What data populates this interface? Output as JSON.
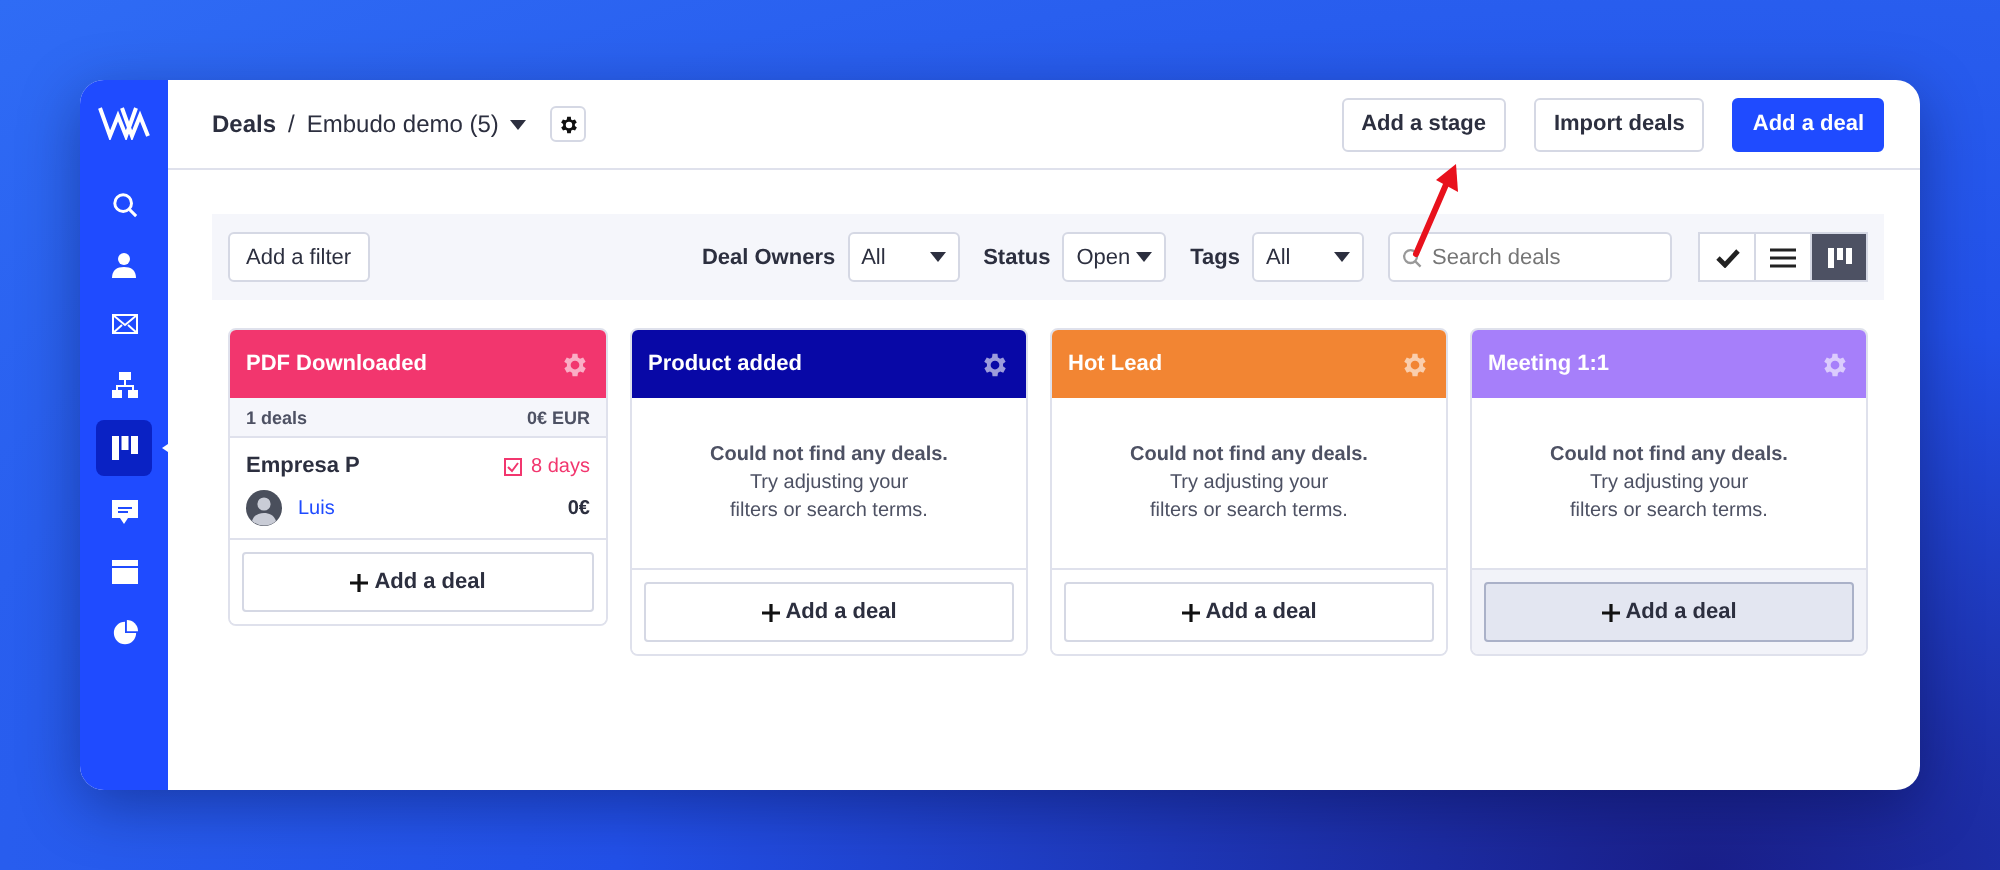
{
  "sidebar": {
    "items": [
      {
        "kind": "search",
        "selected": false
      },
      {
        "kind": "contacts",
        "selected": false
      },
      {
        "kind": "mail",
        "selected": false
      },
      {
        "kind": "flow",
        "selected": false
      },
      {
        "kind": "deals",
        "selected": true
      },
      {
        "kind": "chat",
        "selected": false
      },
      {
        "kind": "window",
        "selected": false
      },
      {
        "kind": "reports",
        "selected": false
      }
    ]
  },
  "header": {
    "breadcrumb": "Deals",
    "separator": "/",
    "pipeline": "Embudo demo (5)",
    "buttons": [
      {
        "label": "Add a stage",
        "primary": false
      },
      {
        "label": "Import deals",
        "primary": false
      },
      {
        "label": "Add a deal",
        "primary": true
      }
    ]
  },
  "filters": {
    "add_filter": "Add a filter",
    "selects": [
      {
        "label": "Deal Owners",
        "value": "All"
      },
      {
        "label": "Status",
        "value": "Open"
      },
      {
        "label": "Tags",
        "value": "All"
      }
    ],
    "search": {
      "placeholder": "Search deals"
    },
    "views": [
      {
        "kind": "check",
        "selected": false
      },
      {
        "kind": "list",
        "selected": false
      },
      {
        "kind": "board",
        "selected": true
      }
    ]
  },
  "stages": [
    {
      "title": "PDF Downloaded",
      "color": "#f2366e",
      "summary": {
        "count": "1 deals",
        "total": "0€ EUR"
      },
      "deals": [
        {
          "name": "Empresa P",
          "due": "8 days",
          "owner": "Luis",
          "amount": "0€"
        }
      ],
      "add": "Add a deal",
      "add_hovered": false
    },
    {
      "title": "Product added",
      "color": "#0808a6",
      "empty": [
        "Could not find any deals.",
        "Try adjusting your",
        "filters or search terms."
      ],
      "add": "Add a deal",
      "add_hovered": false
    },
    {
      "title": "Hot Lead",
      "color": "#f28533",
      "empty": [
        "Could not find any deals.",
        "Try adjusting your",
        "filters or search terms."
      ],
      "add": "Add a deal",
      "add_hovered": false
    },
    {
      "title": "Meeting 1:1",
      "color": "#a67ffa",
      "empty": [
        "Could not find any deals.",
        "Try adjusting your",
        "filters or search terms."
      ],
      "add": "Add a deal",
      "add_hovered": true
    }
  ]
}
